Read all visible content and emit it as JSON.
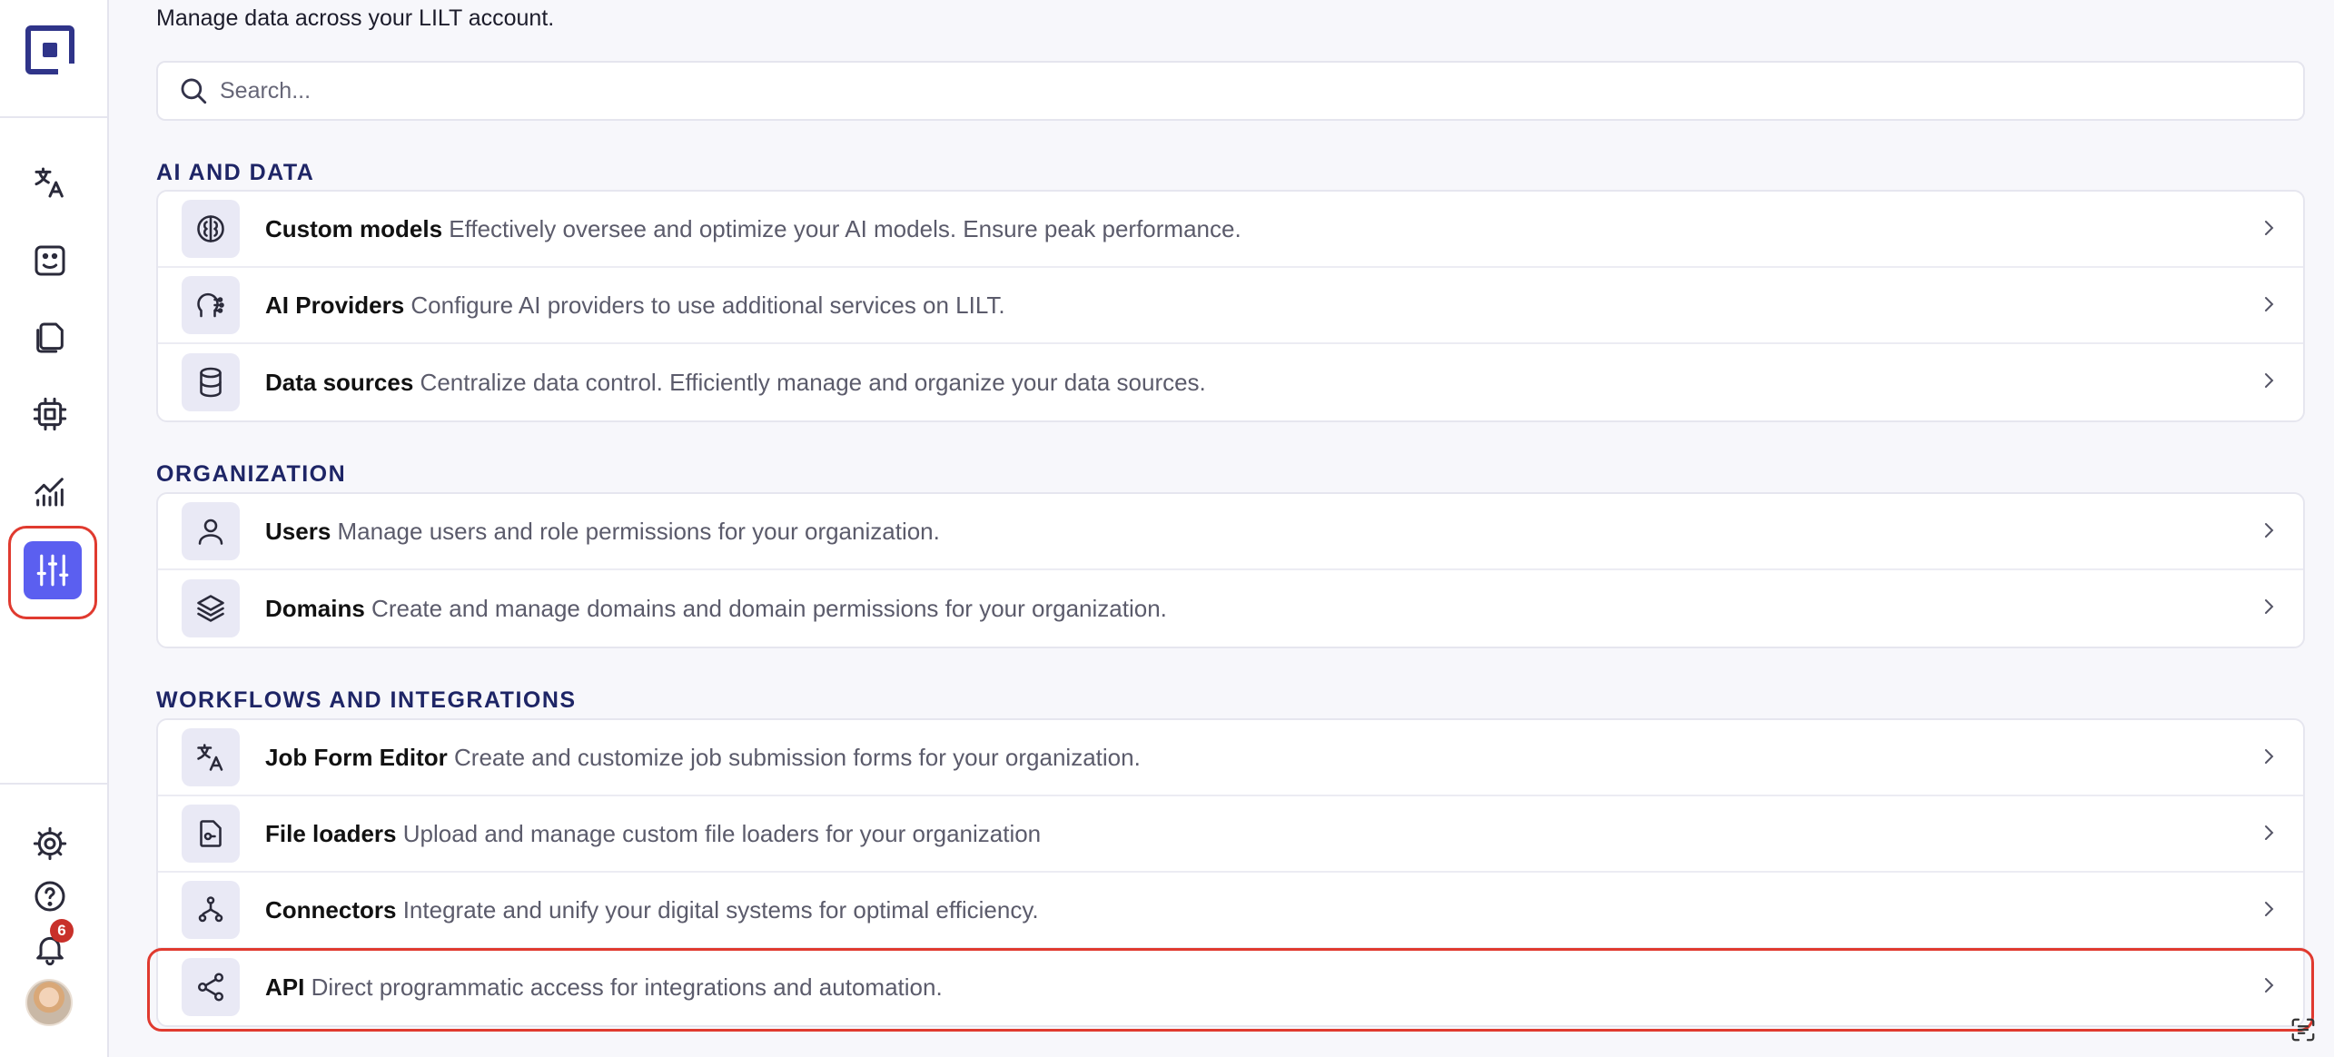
{
  "header": {
    "subtitle": "Manage data across your LILT account."
  },
  "search": {
    "placeholder": "Search..."
  },
  "sidebar": {
    "items": [
      {
        "name": "translate-icon"
      },
      {
        "name": "review-icon"
      },
      {
        "name": "documents-icon"
      },
      {
        "name": "chip-icon"
      },
      {
        "name": "analytics-icon"
      },
      {
        "name": "settings-sliders-icon",
        "active": true
      }
    ],
    "bottom": [
      {
        "name": "gear-icon"
      },
      {
        "name": "help-icon"
      },
      {
        "name": "bell-icon"
      }
    ],
    "notification_count": "6"
  },
  "sections": [
    {
      "title": "AI AND DATA",
      "items": [
        {
          "title": "Custom models",
          "desc": "Effectively oversee and optimize your AI models. Ensure peak performance.",
          "icon": "brain-icon"
        },
        {
          "title": "AI Providers",
          "desc": "Configure AI providers to use additional services on LILT.",
          "icon": "ai-head-icon"
        },
        {
          "title": "Data sources",
          "desc": "Centralize data control. Efficiently manage and organize your data sources.",
          "icon": "database-icon"
        }
      ]
    },
    {
      "title": "ORGANIZATION",
      "items": [
        {
          "title": "Users",
          "desc": "Manage users and role permissions for your organization.",
          "icon": "user-icon"
        },
        {
          "title": "Domains",
          "desc": "Create and manage domains and domain permissions for your organization.",
          "icon": "layers-icon"
        }
      ]
    },
    {
      "title": "WORKFLOWS AND INTEGRATIONS",
      "items": [
        {
          "title": "Job Form Editor",
          "desc": "Create and customize job submission forms for your organization.",
          "icon": "translate-icon"
        },
        {
          "title": "File loaders",
          "desc": "Upload and manage custom file loaders for your organization",
          "icon": "file-loader-icon"
        },
        {
          "title": "Connectors",
          "desc": "Integrate and unify your digital systems for optimal efficiency.",
          "icon": "connector-icon"
        },
        {
          "title": "API",
          "desc": "Direct programmatic access for integrations and automation.",
          "icon": "share-icon"
        }
      ]
    }
  ],
  "colors": {
    "accent": "#5b5ff0",
    "brand": "#2f3489",
    "highlight": "#e03a2f",
    "badge": "#c8302a"
  }
}
